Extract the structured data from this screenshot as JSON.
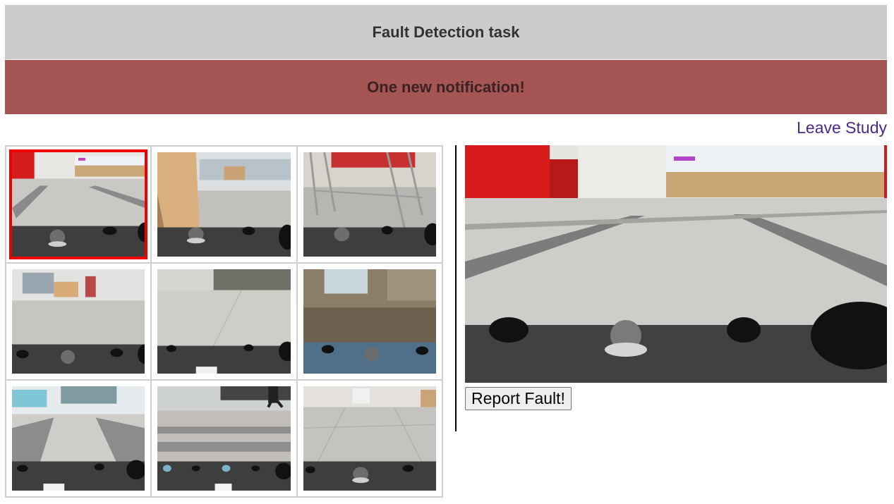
{
  "header": {
    "title": "Fault Detection task"
  },
  "notification": {
    "text": "One new notification!"
  },
  "nav": {
    "leave_label": "Leave Study"
  },
  "actions": {
    "report_label": "Report Fault!"
  },
  "colors": {
    "title_bg": "#cccccc",
    "notification_bg": "#a65555",
    "link": "#4b2a8a",
    "selected_border": "#ee0000"
  },
  "feeds": [
    {
      "name": "camera-feed-1",
      "selected": true
    },
    {
      "name": "camera-feed-2",
      "selected": false
    },
    {
      "name": "camera-feed-3",
      "selected": false
    },
    {
      "name": "camera-feed-4",
      "selected": false
    },
    {
      "name": "camera-feed-5",
      "selected": false
    },
    {
      "name": "camera-feed-6",
      "selected": false
    },
    {
      "name": "camera-feed-7",
      "selected": false
    },
    {
      "name": "camera-feed-8",
      "selected": false
    },
    {
      "name": "camera-feed-9",
      "selected": false
    }
  ]
}
